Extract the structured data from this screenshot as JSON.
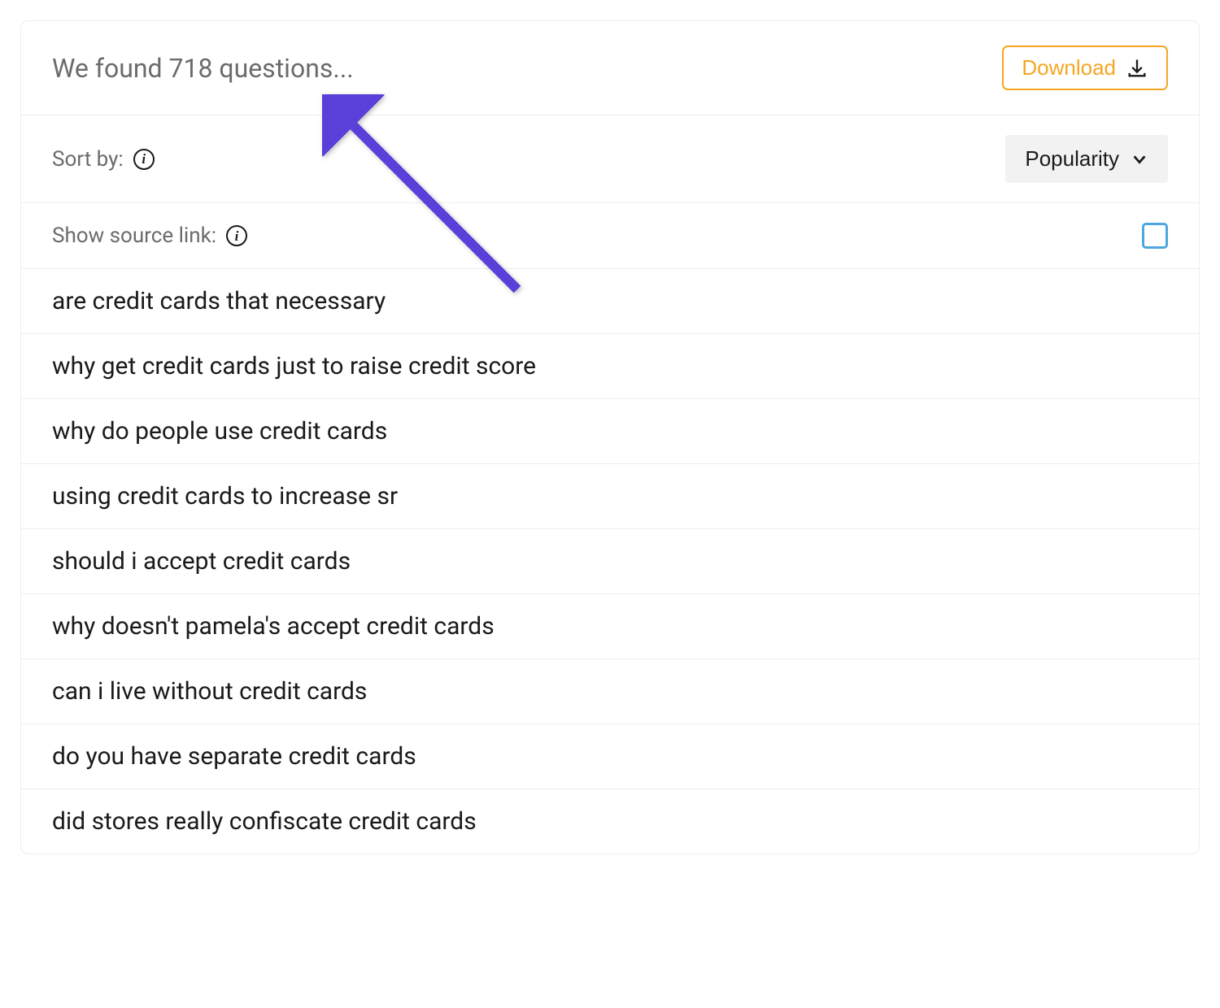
{
  "header": {
    "result_text": "We found 718 questions...",
    "download_label": "Download"
  },
  "controls": {
    "sort_label": "Sort by:",
    "sort_value": "Popularity",
    "show_source_label": "Show source link:"
  },
  "questions": [
    "are credit cards that necessary",
    "why get credit cards just to raise credit score",
    "why do people use credit cards",
    "using credit cards to increase sr",
    "should i accept credit cards",
    "why doesn't pamela's accept credit cards",
    "can i live without credit cards",
    "do you have separate credit cards",
    "did stores really confiscate credit cards"
  ],
  "colors": {
    "accent_orange": "#f5a623",
    "checkbox_blue": "#4da6e0",
    "arrow_purple": "#5b3fd9"
  }
}
